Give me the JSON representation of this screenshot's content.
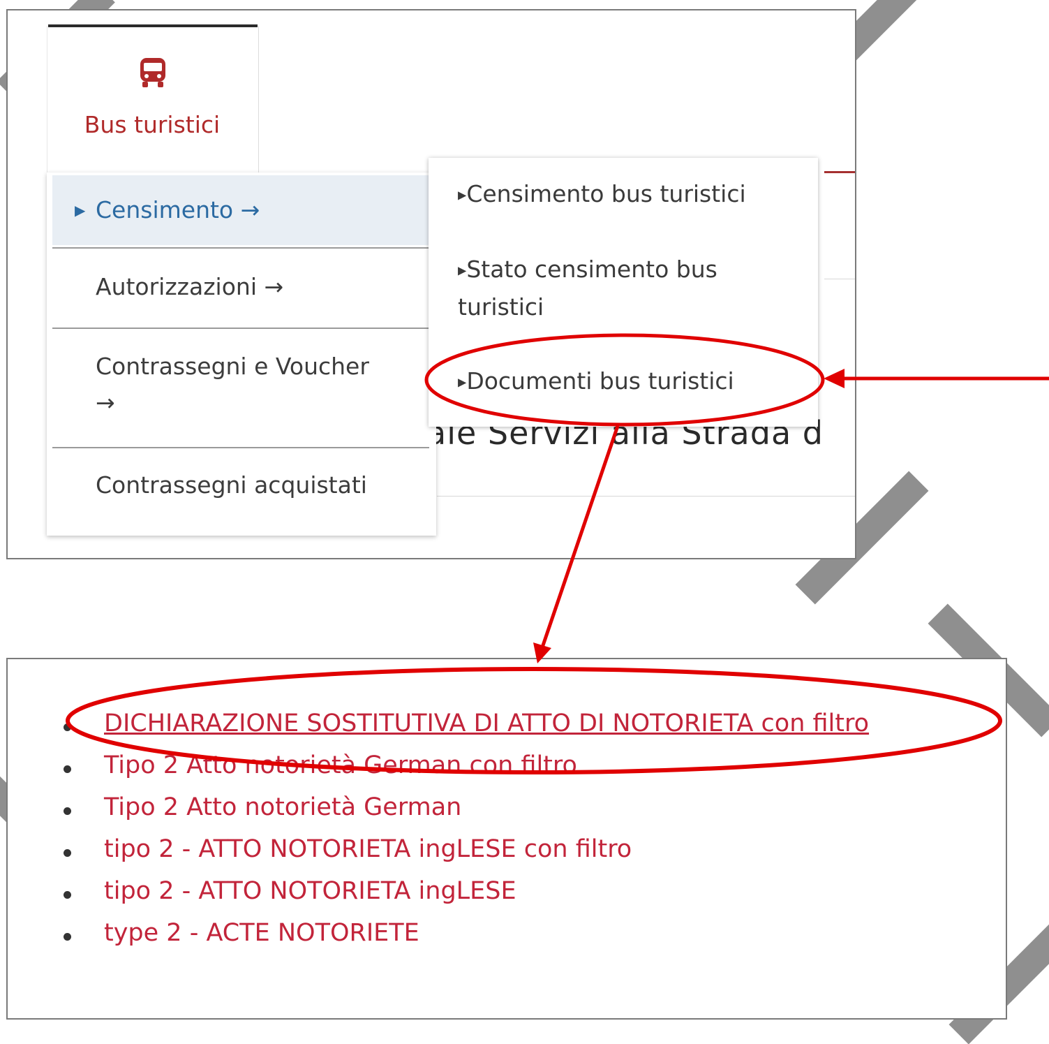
{
  "top": {
    "tab_label": "Bus turistici",
    "background_text": "ale Servizi alla Strada d",
    "menu": [
      {
        "label": "Censimento",
        "arrow": "→",
        "active": true
      },
      {
        "label": "Autorizzazioni",
        "arrow": "→",
        "active": false
      },
      {
        "label": "Contrassegni e Voucher",
        "arrow": "→",
        "active": false
      },
      {
        "label": "Contrassegni acquistati",
        "arrow": "",
        "active": false
      }
    ],
    "submenu": [
      {
        "label": "Censimento bus turistici"
      },
      {
        "label": "Stato censimento bus",
        "label2": "turistici"
      },
      {
        "label": "Documenti bus turistici"
      }
    ]
  },
  "documents": [
    "DICHIARAZIONE SOSTITUTIVA DI ATTO DI NOTORIETA con filtro",
    "Tipo 2 Atto notorietà German con filtro",
    "Tipo 2 Atto notorietà German",
    "tipo 2 - ATTO NOTORIETA ingLESE con filtro",
    "tipo 2 - ATTO NOTORIETA ingLESE",
    "type 2 - ACTE NOTORIETE"
  ],
  "colors": {
    "brand_red": "#b02a2a",
    "link_red": "#c2243a",
    "annotation_red": "#e00000",
    "active_blue": "#2b6aa2"
  }
}
